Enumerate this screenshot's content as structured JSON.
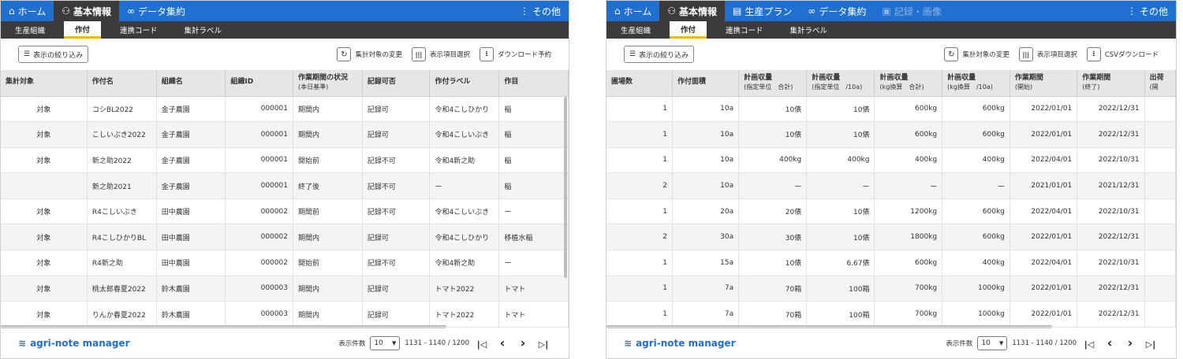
{
  "left": {
    "nav": [
      {
        "icon": "home-icon",
        "label": "ホーム",
        "active": false,
        "disabled": false
      },
      {
        "icon": "people-icon",
        "label": "基本情報",
        "active": true,
        "disabled": false
      },
      {
        "icon": "binoculars-icon",
        "label": "データ集約",
        "active": false,
        "disabled": false
      }
    ],
    "nav_more": "その他",
    "subnav": [
      "生産組織",
      "作付",
      "連携コード",
      "集計ラベル"
    ],
    "subnav_active": 1,
    "filter_label": "表示の絞り込み",
    "tools": [
      {
        "icon": "refresh-icon",
        "label": "集計対象の変更"
      },
      {
        "icon": "columns-icon",
        "label": "表示項目選択"
      },
      {
        "icon": "download-icon",
        "label": "ダウンロード予約"
      }
    ],
    "columns": [
      {
        "label": "集計対象",
        "sub": "",
        "w": 110
      },
      {
        "label": "作付名",
        "sub": "",
        "w": 88
      },
      {
        "label": "組織名",
        "sub": "",
        "w": 88
      },
      {
        "label": "組織ID",
        "sub": "",
        "w": 86
      },
      {
        "label": "作業期間の状況",
        "sub": "(本日基準)",
        "w": 88
      },
      {
        "label": "記録可否",
        "sub": "",
        "w": 86
      },
      {
        "label": "作付ラベル",
        "sub": "",
        "w": 88
      },
      {
        "label": "作目",
        "sub": "",
        "w": 88
      }
    ],
    "aligns": [
      "c",
      "l",
      "l",
      "r",
      "l",
      "l",
      "l",
      "l"
    ],
    "rows": [
      [
        "対象",
        "コシBL2022",
        "金子農園",
        "000001",
        "期間内",
        "記録可",
        "令和4こしひかり",
        "稲"
      ],
      [
        "対象",
        "こしいぶき2022",
        "金子農園",
        "000001",
        "期間内",
        "記録可",
        "令和4こしいぶき",
        "稲"
      ],
      [
        "対象",
        "新之助2022",
        "金子農園",
        "000001",
        "開始前",
        "記録不可",
        "令和4新之助",
        "稲"
      ],
      [
        "",
        "新之助2021",
        "金子農園",
        "000001",
        "終了後",
        "記録不可",
        "ー",
        "稲"
      ],
      [
        "対象",
        "R4こしいぶき",
        "田中農園",
        "000002",
        "期間前",
        "記録不可",
        "令和4こしいぶき",
        "ー"
      ],
      [
        "対象",
        "R4こしひかりBL",
        "田中農園",
        "000002",
        "期間内",
        "記録可",
        "令和4こしひかり",
        "移植水稲"
      ],
      [
        "対象",
        "R4新之助",
        "田中農園",
        "000002",
        "開始前",
        "記録不可",
        "令和4新之助",
        "ー"
      ],
      [
        "対象",
        "桃太郎春夏2022",
        "鈴木農園",
        "000003",
        "期間内",
        "記録可",
        "トマト2022",
        "トマト"
      ],
      [
        "対象",
        "りんか春夏2022",
        "鈴木農園",
        "000003",
        "期間内",
        "記録可",
        "トマト2022",
        "トマト"
      ]
    ],
    "logo": "agri-note manager",
    "page_size_label": "表示件数",
    "page_size": "10",
    "range": "1131 - 1140 / 1200"
  },
  "right": {
    "nav": [
      {
        "icon": "home-icon",
        "label": "ホーム",
        "active": false,
        "disabled": false
      },
      {
        "icon": "people-icon",
        "label": "基本情報",
        "active": true,
        "disabled": false
      },
      {
        "icon": "document-icon",
        "label": "生産プラン",
        "active": false,
        "disabled": false
      },
      {
        "icon": "binoculars-icon",
        "label": "データ集約",
        "active": false,
        "disabled": false
      },
      {
        "icon": "image-icon",
        "label": "記録・画像",
        "active": false,
        "disabled": true
      }
    ],
    "nav_more": "その他",
    "subnav": [
      "生産組織",
      "作付",
      "連携コード",
      "集計ラベル"
    ],
    "subnav_active": 1,
    "filter_label": "表示の絞り込み",
    "tools": [
      {
        "icon": "refresh-icon",
        "label": "集計対象の変更"
      },
      {
        "icon": "columns-icon",
        "label": "表示項目選択"
      },
      {
        "icon": "download-icon",
        "label": "CSVダウンロード"
      }
    ],
    "columns": [
      {
        "label": "圃場数",
        "sub": "",
        "w": 87
      },
      {
        "label": "作付面積",
        "sub": "",
        "w": 87
      },
      {
        "label": "計画収量",
        "sub": "(指定単位　合計)",
        "w": 87
      },
      {
        "label": "計画収量",
        "sub": "(指定単位　/10a)",
        "w": 87
      },
      {
        "label": "計画収量",
        "sub": "(kg換算　合計)",
        "w": 87
      },
      {
        "label": "計画収量",
        "sub": "(kg換算　/10a)",
        "w": 87
      },
      {
        "label": "作業期間",
        "sub": "(開始)",
        "w": 87
      },
      {
        "label": "作業期間",
        "sub": "(終了)",
        "w": 87
      },
      {
        "label": "出荷",
        "sub": "(開",
        "w": 40
      }
    ],
    "aligns": [
      "r",
      "r",
      "r",
      "r",
      "r",
      "r",
      "r",
      "r",
      "r"
    ],
    "rows": [
      [
        "1",
        "10a",
        "10俵",
        "10俵",
        "600kg",
        "600kg",
        "2022/01/01",
        "2022/12/31",
        ""
      ],
      [
        "1",
        "10a",
        "10俵",
        "10俵",
        "600kg",
        "600kg",
        "2022/01/01",
        "2022/12/31",
        ""
      ],
      [
        "1",
        "10a",
        "400kg",
        "400kg",
        "400kg",
        "400kg",
        "2022/04/01",
        "2022/10/31",
        ""
      ],
      [
        "2",
        "10a",
        "ー",
        "ー",
        "ー",
        "ー",
        "2021/01/01",
        "2021/12/31",
        ""
      ],
      [
        "1",
        "20a",
        "20俵",
        "10俵",
        "1200kg",
        "600kg",
        "2022/04/01",
        "2022/10/31",
        ""
      ],
      [
        "2",
        "30a",
        "30俵",
        "10俵",
        "1800kg",
        "600kg",
        "2022/01/01",
        "2022/12/31",
        ""
      ],
      [
        "1",
        "15a",
        "10俵",
        "6.67俵",
        "600kg",
        "400kg",
        "2022/04/01",
        "2022/10/31",
        ""
      ],
      [
        "1",
        "7a",
        "70箱",
        "100箱",
        "700kg",
        "1000kg",
        "2022/01/01",
        "2022/12/31",
        ""
      ],
      [
        "1",
        "7a",
        "70箱",
        "100箱",
        "700kg",
        "1000kg",
        "2022/01/01",
        "2022/12/31",
        ""
      ]
    ],
    "logo": "agri-note manager",
    "page_size_label": "表示件数",
    "page_size": "10",
    "range": "1131 - 1140 / 1200"
  }
}
